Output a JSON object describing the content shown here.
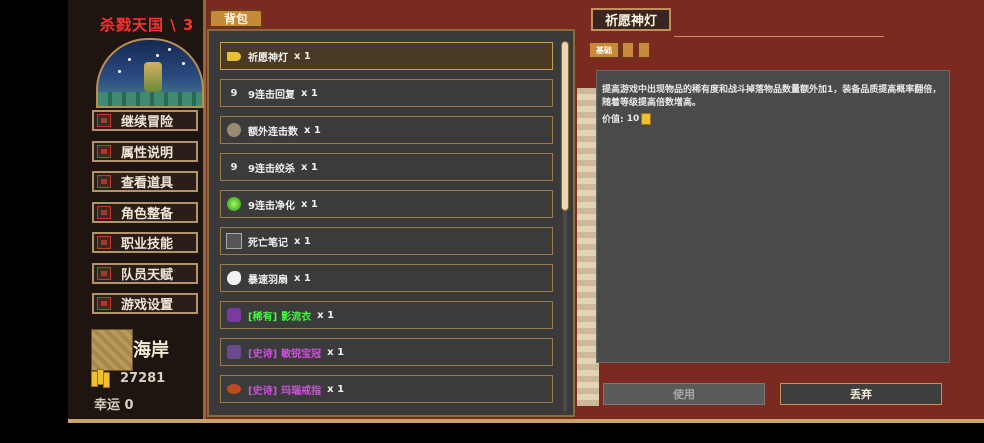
{
  "sidebar": {
    "realm_title": "杀戮天国 \\ 3",
    "menu": [
      {
        "label": "继续冒险"
      },
      {
        "label": "属性说明"
      },
      {
        "label": "查看道具"
      },
      {
        "label": "角色整备"
      },
      {
        "label": "职业技能"
      },
      {
        "label": "队员天赋"
      },
      {
        "label": "游戏设置"
      }
    ],
    "terrain": "海岸",
    "gold": "27281",
    "luck": "幸运 0"
  },
  "bag": {
    "tab_label": "背包",
    "items": [
      {
        "name": "祈愿神灯",
        "qty": "x 1",
        "tag": "",
        "icon": "lamp-icon",
        "color": "#f0f0f0",
        "selected": true
      },
      {
        "name": "9连击回复",
        "qty": "x 1",
        "tag": "",
        "icon": "digit-9-icon",
        "color": "#f0f0f0"
      },
      {
        "name": "额外连击数",
        "qty": "x 1",
        "tag": "",
        "icon": "stone-icon",
        "color": "#f0f0f0"
      },
      {
        "name": "9连击绞杀",
        "qty": "x 1",
        "tag": "",
        "icon": "digit-9-icon",
        "color": "#f0f0f0"
      },
      {
        "name": "9连击净化",
        "qty": "x 1",
        "tag": "",
        "icon": "green-orb-icon",
        "color": "#f0f0f0"
      },
      {
        "name": "死亡笔记",
        "qty": "x 1",
        "tag": "",
        "icon": "book-icon",
        "color": "#f0f0f0"
      },
      {
        "name": "暴速羽扇",
        "qty": "x 1",
        "tag": "",
        "icon": "fan-icon",
        "color": "#f0f0f0"
      },
      {
        "name": "影流衣",
        "qty": "x 1",
        "tag": "[稀有]",
        "icon": "robe-icon",
        "color": "#3cff3c"
      },
      {
        "name": "敏锐宝冠",
        "qty": "x 1",
        "tag": "[史诗]",
        "icon": "crown-icon",
        "color": "#d050e0"
      },
      {
        "name": "玛瑙戒指",
        "qty": "x 1",
        "tag": "[史诗]",
        "icon": "ring-icon",
        "color": "#d050e0"
      }
    ]
  },
  "detail": {
    "title": "祈愿神灯",
    "subtab_active": "基础",
    "description": "提高游戏中出现物品的稀有度和战斗掉落物品数量额外加1，装备品质提高概率翻倍，随着等级提高倍数增高。",
    "value_label": "价值:",
    "value": "10",
    "use_label": "使用",
    "drop_label": "丢弃"
  },
  "colors": {
    "rare": "#3cff3c",
    "epic": "#d050e0",
    "frame": "#7a2a1f",
    "border_gold": "#c49058"
  }
}
